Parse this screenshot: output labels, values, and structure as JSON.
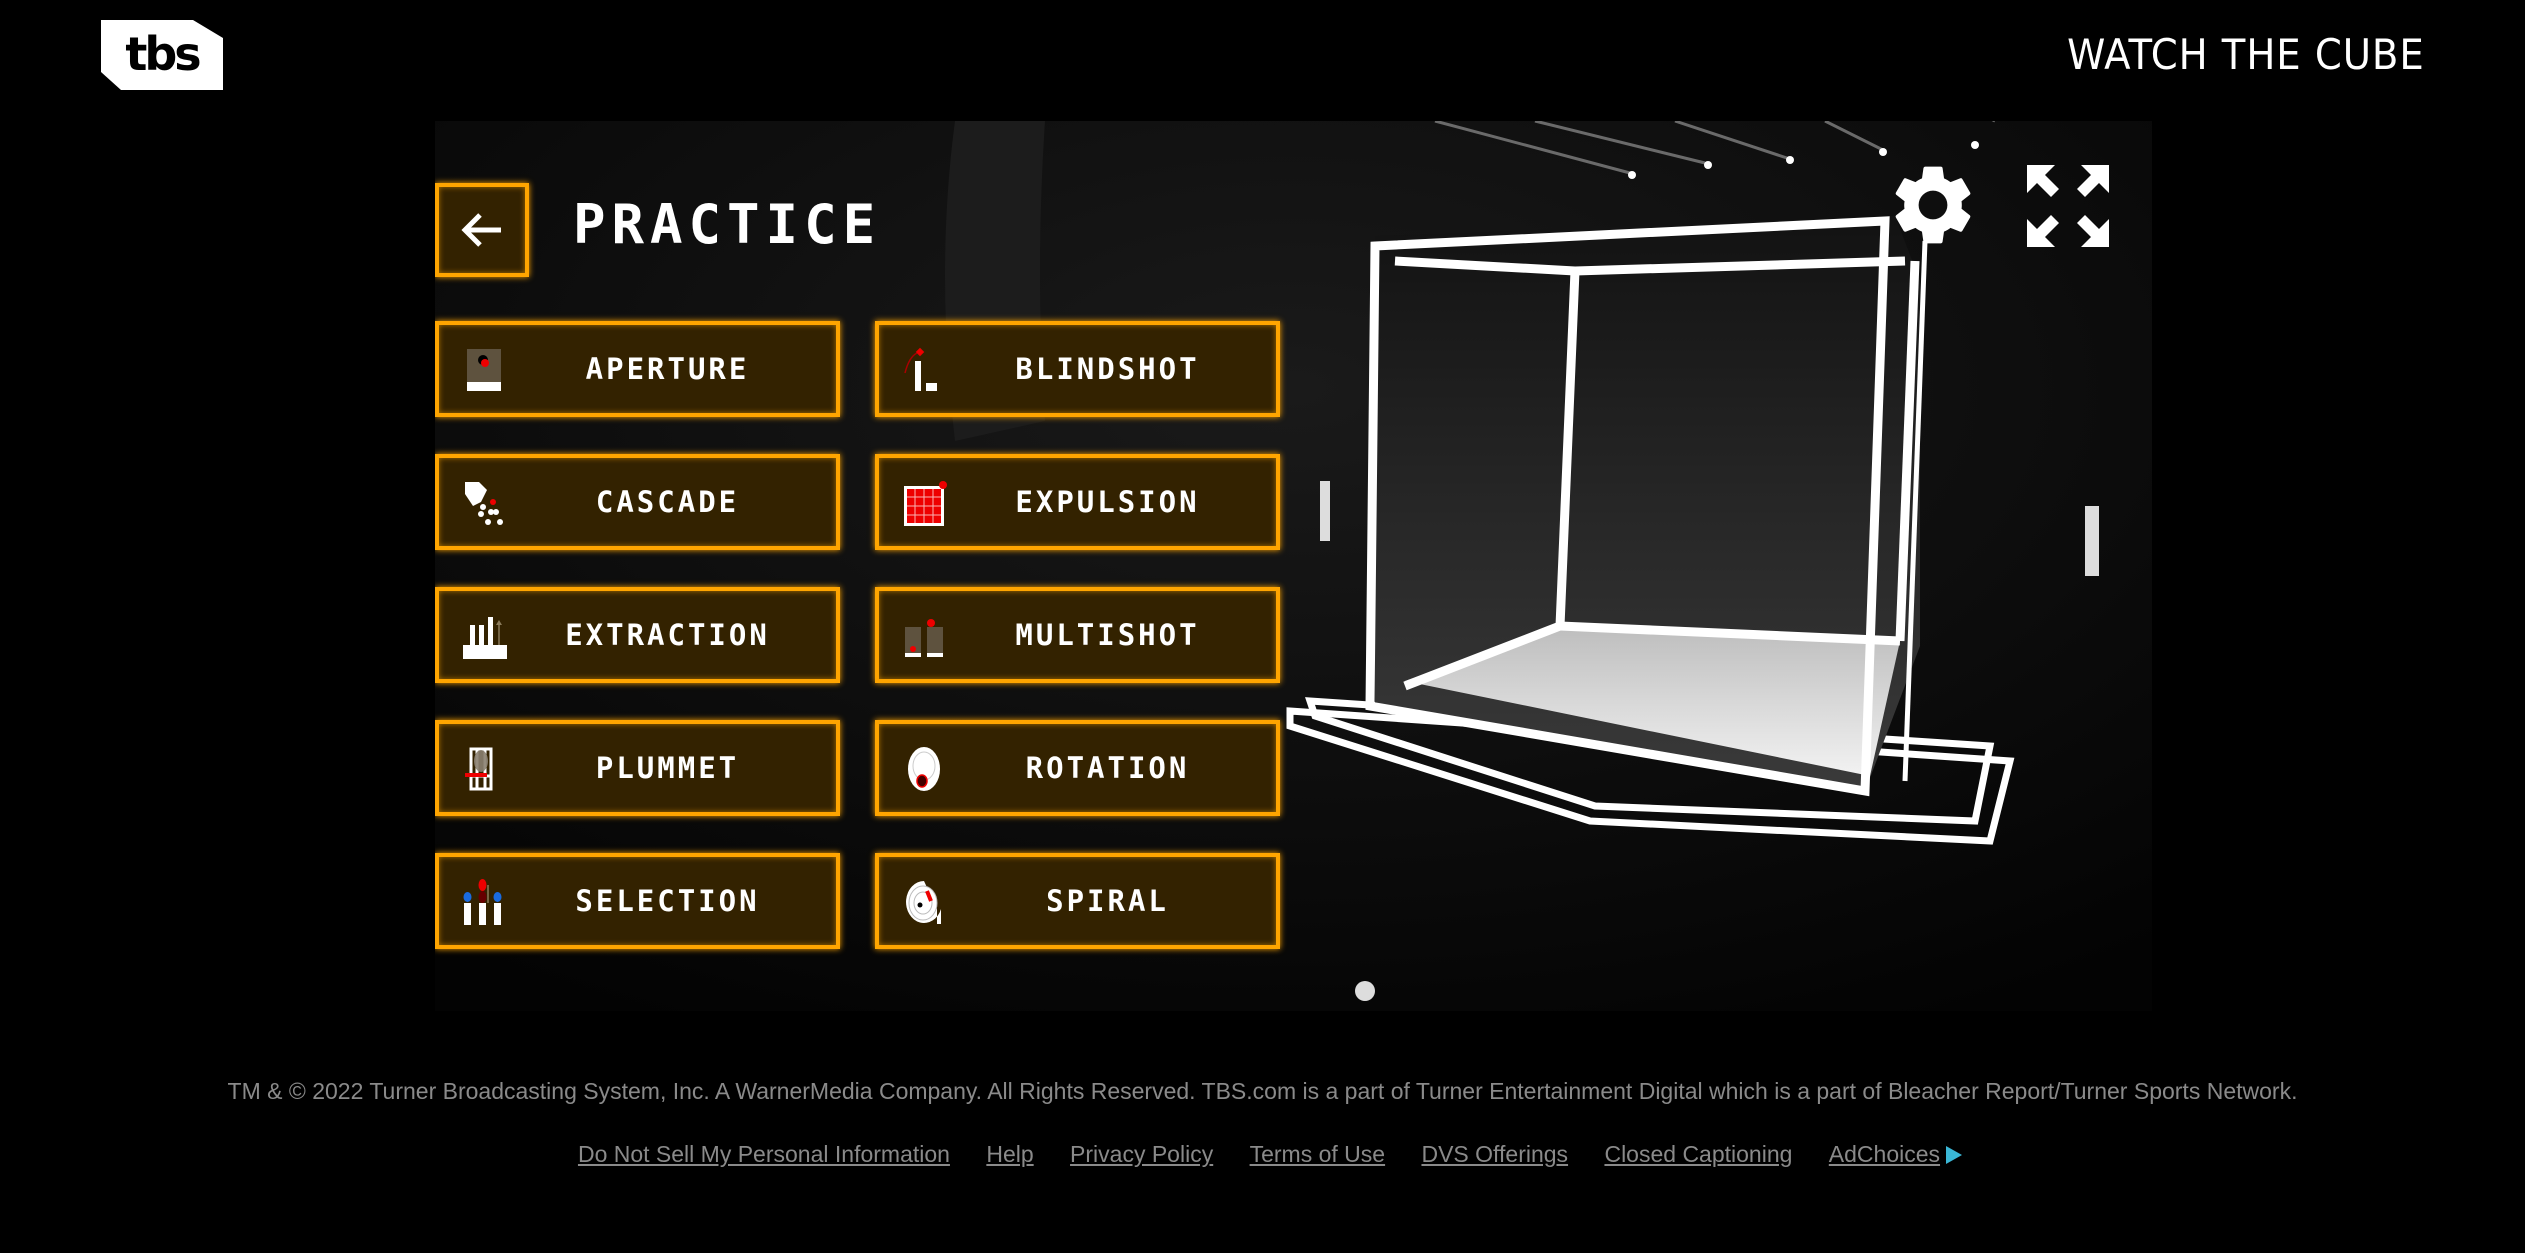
{
  "header": {
    "logo_text": "tbs",
    "watch_link": "WATCH THE CUBE"
  },
  "game": {
    "title": "PRACTICE",
    "back_icon": "arrow-left-icon",
    "settings_icon": "gear-icon",
    "fullscreen_icon": "fullscreen-expand-icon",
    "accent_color": "#ffa500",
    "button_fill": "#332200",
    "modes": [
      {
        "label": "APERTURE",
        "icon": "aperture-icon"
      },
      {
        "label": "BLINDSHOT",
        "icon": "blindshot-icon"
      },
      {
        "label": "CASCADE",
        "icon": "cascade-icon"
      },
      {
        "label": "EXPULSION",
        "icon": "expulsion-icon"
      },
      {
        "label": "EXTRACTION",
        "icon": "extraction-icon"
      },
      {
        "label": "MULTISHOT",
        "icon": "multishot-icon"
      },
      {
        "label": "PLUMMET",
        "icon": "plummet-icon"
      },
      {
        "label": "ROTATION",
        "icon": "rotation-icon"
      },
      {
        "label": "SELECTION",
        "icon": "selection-icon"
      },
      {
        "label": "SPIRAL",
        "icon": "spiral-icon"
      }
    ]
  },
  "footer": {
    "copyright": "TM & © 2022 Turner Broadcasting System, Inc. A WarnerMedia Company. All Rights Reserved. TBS.com is a part of Turner Entertainment Digital which is a part of Bleacher Report/Turner Sports Network.",
    "links": [
      "Do Not Sell My Personal Information",
      "Help",
      "Privacy Policy",
      "Terms of Use",
      "DVS Offerings",
      "Closed Captioning",
      "AdChoices"
    ]
  }
}
